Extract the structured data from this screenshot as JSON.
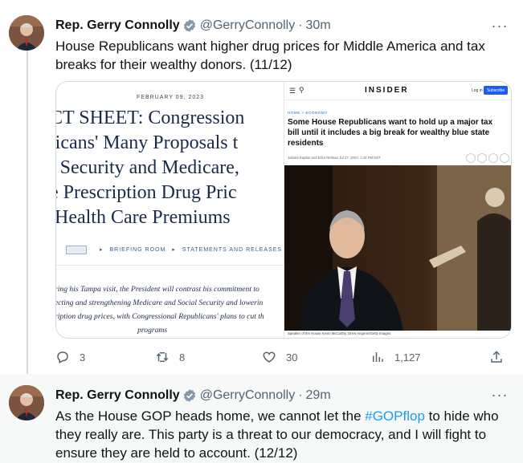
{
  "tweets": [
    {
      "author_name": "Rep. Gerry Connolly",
      "handle": "@GerryConnolly",
      "separator": "·",
      "time": "30m",
      "text": "House Republicans want higher drug prices for Middle America and tax breaks for their wealthy donors. (11/12)",
      "media": {
        "fact_sheet": {
          "date": "FEBRUARY 09, 2023",
          "title_lines": [
            "CT SHEET: Congression",
            "licans' Many Proposals t",
            "l Security and Medicare,",
            "e Prescription Drug Pric",
            " Health Care Premiums"
          ],
          "nav_briefing": "BRIEFING ROOM",
          "nav_statements": "STATEMENTS AND RELEASES",
          "body_lines": [
            "ring his Tampa visit, the President will contrast his commitment to",
            "ecting and strengthening Medicare and Social Security and lowerin",
            "ription drug prices, with Congressional Republicans' plans to cut th",
            "                                           programs"
          ]
        },
        "insider": {
          "logo": "INSIDER",
          "login": "Log in",
          "subscribe": "Subscribe",
          "breadcrumb": "HOME  >  ECONOMY",
          "headline": "Some House Republicans want to hold up a major tax bill until it includes a big break for wealthy blue state residents",
          "byline": "Juliana Kaplan and Eliza Relman   Jul 27, 2023, 1:44 PM EDT",
          "caption": "Speaker of the House Kevin McCarthy.  Drew Angerer/Getty Images"
        }
      },
      "actions": {
        "reply_count": "3",
        "retweet_count": "8",
        "like_count": "30",
        "views_count": "1,127"
      }
    },
    {
      "author_name": "Rep. Gerry Connolly",
      "handle": "@GerryConnolly",
      "separator": "·",
      "time": "29m",
      "text_before": "As the House GOP heads home, we cannot let the ",
      "hashtag": "#GOPflop",
      "text_after": " to hide who they really are. This party is a threat to our democracy, and I will fight to ensure they are held to account. (12/12)"
    }
  ],
  "more_label": "···",
  "colors": {
    "accent": "#1d9bf0",
    "muted": "#536471",
    "text": "#0f1419",
    "highlight_bg": "#f7f9f9"
  },
  "icons": {
    "verified": "verified-badge-icon",
    "reply": "reply-icon",
    "retweet": "retweet-icon",
    "like": "heart-icon",
    "views": "views-icon",
    "share": "share-icon",
    "more": "more-icon"
  }
}
